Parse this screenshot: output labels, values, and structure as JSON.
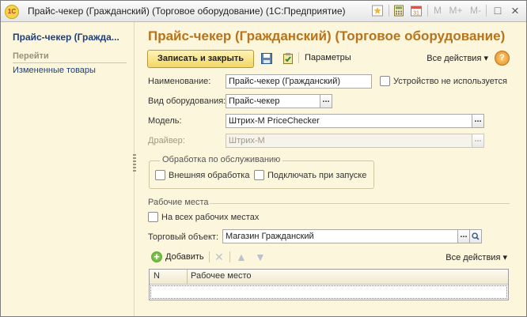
{
  "window": {
    "title": "Прайс-чекер (Гражданский) (Торговое оборудование)  (1С:Предприятие)",
    "logo_text": "1С",
    "controls": {
      "m": "M",
      "m_plus": "M+",
      "m_minus": "M-",
      "restore": "□",
      "close": "×"
    }
  },
  "left_panel": {
    "title": "Прайс-чекер (Гражда...",
    "section": "Перейти",
    "link": "Измененные товары"
  },
  "form": {
    "title": "Прайс-чекер (Гражданский) (Торговое оборудование)",
    "toolbar": {
      "save_close": "Записать и закрыть",
      "params": "Параметры",
      "all_actions": "Все действия ▾",
      "help": "?"
    },
    "fields": {
      "name_label": "Наименование:",
      "name_value": "Прайс-чекер (Гражданский)",
      "unused_label": "Устройство не используется",
      "type_label": "Вид оборудования:",
      "type_value": "Прайс-чекер",
      "model_label": "Модель:",
      "model_value": "Штрих-М PriceChecker",
      "driver_label": "Драйвер:",
      "driver_value": "Штрих-М",
      "dots": "..."
    },
    "service_group": {
      "title": "Обработка по обслуживанию",
      "external": "Внешняя обработка",
      "on_start": "Подключать при запуске"
    },
    "workplaces": {
      "title": "Рабочие места",
      "all_places": "На всех рабочих местах",
      "store_label": "Торговый объект:",
      "store_value": "Магазин Гражданский",
      "add": "Добавить",
      "all_actions": "Все действия ▾",
      "columns": [
        "N",
        "Рабочее место"
      ]
    }
  }
}
